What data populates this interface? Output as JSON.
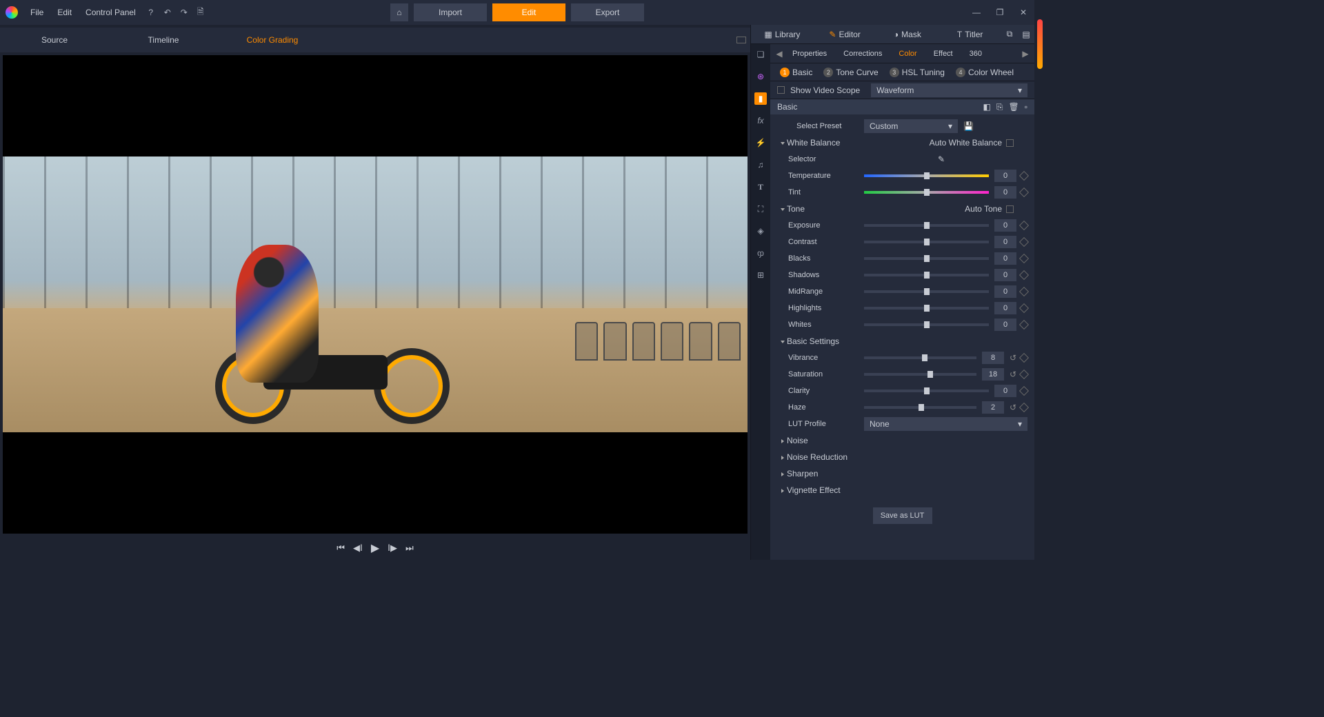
{
  "menu": {
    "file": "File",
    "edit": "Edit",
    "cp": "Control Panel"
  },
  "topbtns": {
    "import": "Import",
    "edit": "Edit",
    "export": "Export"
  },
  "lefttabs": {
    "source": "Source",
    "timeline": "Timeline",
    "cg": "Color Grading"
  },
  "righttop": {
    "library": "Library",
    "editor": "Editor",
    "mask": "Mask",
    "title": "Titler"
  },
  "subtabs": {
    "props": "Properties",
    "corr": "Corrections",
    "color": "Color",
    "effect": "Effect",
    "v360": "360"
  },
  "sub2": {
    "basic": "Basic",
    "tc": "Tone Curve",
    "hsl": "HSL Tuning",
    "cw": "Color Wheel"
  },
  "scope": {
    "label": "Show Video Scope",
    "dd": "Waveform"
  },
  "basichdr": "Basic",
  "preset": {
    "label": "Select Preset",
    "val": "Custom"
  },
  "wb": {
    "section": "White Balance",
    "auto": "Auto White Balance",
    "selector": "Selector",
    "temp": "Temperature",
    "tempv": "0",
    "tint": "Tint",
    "tintv": "0"
  },
  "tone": {
    "section": "Tone",
    "auto": "Auto Tone",
    "exposure": "Exposure",
    "exposurev": "0",
    "contrast": "Contrast",
    "contrastv": "0",
    "blacks": "Blacks",
    "blacksv": "0",
    "shadows": "Shadows",
    "shadowsv": "0",
    "mid": "MidRange",
    "midv": "0",
    "hl": "Highlights",
    "hlv": "0",
    "whites": "Whites",
    "whitesv": "0"
  },
  "bs": {
    "section": "Basic Settings",
    "vib": "Vibrance",
    "vibv": "8",
    "sat": "Saturation",
    "satv": "18",
    "clar": "Clarity",
    "clarv": "0",
    "haze": "Haze",
    "hazev": "2",
    "lut": "LUT Profile",
    "lutv": "None"
  },
  "collapsed": {
    "noise": "Noise",
    "nr": "Noise Reduction",
    "sharpen": "Sharpen",
    "vig": "Vignette Effect"
  },
  "savelut": "Save as LUT"
}
